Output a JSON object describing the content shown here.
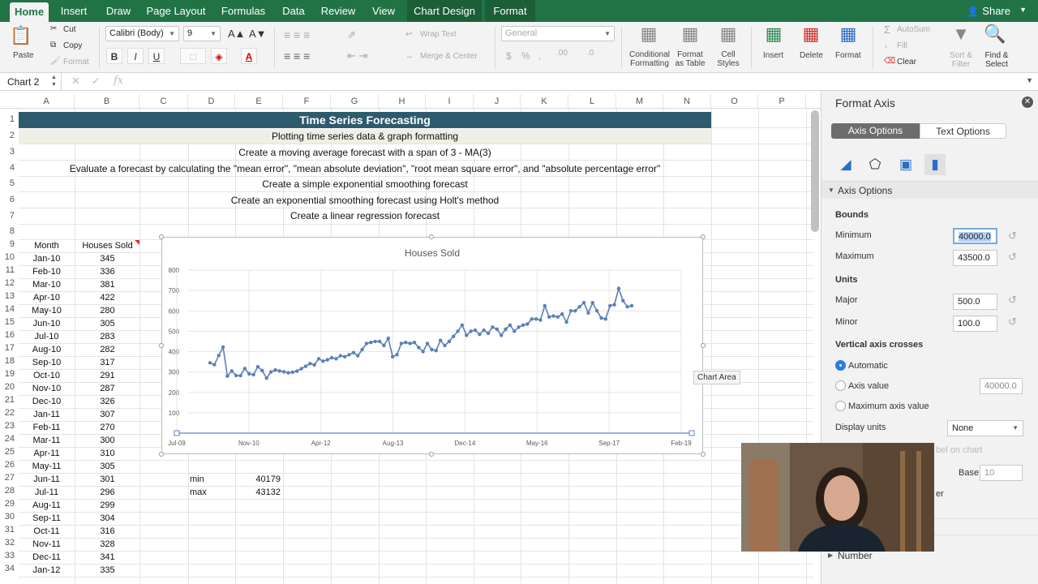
{
  "tabs": [
    "Home",
    "Insert",
    "Draw",
    "Page Layout",
    "Formulas",
    "Data",
    "Review",
    "View",
    "Chart Design",
    "Format"
  ],
  "share": "Share",
  "ribbon": {
    "paste": "Paste",
    "cut": "Cut",
    "copy": "Copy",
    "format": "Format",
    "font": "Calibri (Body)",
    "size": "9",
    "bold": "B",
    "italic": "I",
    "underline": "U",
    "wrap": "Wrap Text",
    "merge": "Merge & Center",
    "numfmt": "General",
    "pct": "%",
    "cond": "Conditional\nFormatting",
    "fmt_table": "Format\nas Table",
    "cell_styles": "Cell\nStyles",
    "insert": "Insert",
    "delete": "Delete",
    "format_btn": "Format",
    "autosum": "AutoSum",
    "fill": "Fill",
    "clear": "Clear",
    "sort": "Sort &\nFilter",
    "find": "Find &\nSelect"
  },
  "namebox": "Chart 2",
  "fx": "fx",
  "columns": [
    "A",
    "B",
    "C",
    "D",
    "E",
    "F",
    "G",
    "H",
    "I",
    "J",
    "K",
    "L",
    "M",
    "N",
    "O",
    "P"
  ],
  "banners": [
    "Time Series Forecasting",
    "Plotting time series data & graph formatting",
    "Create a moving average forecast with a span of 3 - MA(3)",
    "Evaluate a forecast by calculating the \"mean error\", \"mean absolute deviation\", \"root mean square error\", and \"absolute percentage error\"",
    "Create a simple exponential smoothing forecast",
    "Create an exponential smoothing forecast using Holt's method",
    "Create a linear regression forecast"
  ],
  "hdr": {
    "month": "Month",
    "sold": "Houses Sold"
  },
  "rows": [
    [
      "Jan-10",
      "345"
    ],
    [
      "Feb-10",
      "336"
    ],
    [
      "Mar-10",
      "381"
    ],
    [
      "Apr-10",
      "422"
    ],
    [
      "May-10",
      "280"
    ],
    [
      "Jun-10",
      "305"
    ],
    [
      "Jul-10",
      "283"
    ],
    [
      "Aug-10",
      "282"
    ],
    [
      "Sep-10",
      "317"
    ],
    [
      "Oct-10",
      "291"
    ],
    [
      "Nov-10",
      "287"
    ],
    [
      "Dec-10",
      "326"
    ],
    [
      "Jan-11",
      "307"
    ],
    [
      "Feb-11",
      "270"
    ],
    [
      "Mar-11",
      "300"
    ],
    [
      "Apr-11",
      "310"
    ],
    [
      "May-11",
      "305"
    ],
    [
      "Jun-11",
      "301"
    ],
    [
      "Jul-11",
      "296"
    ],
    [
      "Aug-11",
      "299"
    ],
    [
      "Sep-11",
      "304"
    ],
    [
      "Oct-11",
      "316"
    ],
    [
      "Nov-11",
      "328"
    ],
    [
      "Dec-11",
      "341"
    ],
    [
      "Jan-12",
      "335"
    ]
  ],
  "minmax": {
    "min_lbl": "min",
    "min_val": "40179",
    "max_lbl": "max",
    "max_val": "43132"
  },
  "chart_tip": "Chart Area",
  "chart_data": {
    "type": "line",
    "title": "Houses Sold",
    "xlabel": "",
    "ylabel": "",
    "ylim": [
      0,
      800
    ],
    "yticks": [
      "0",
      "100",
      "200",
      "300",
      "400",
      "500",
      "600",
      "700",
      "800"
    ],
    "xtick_labels": [
      "Jul-09",
      "Nov-10",
      "Apr-12",
      "Aug-13",
      "Dec-14",
      "May-16",
      "Sep-17",
      "Feb-19"
    ],
    "series": [
      {
        "values": [
          345,
          336,
          381,
          422,
          280,
          305,
          283,
          282,
          317,
          291,
          287,
          326,
          307,
          270,
          300,
          310,
          305,
          301,
          296,
          299,
          304,
          316,
          328,
          341,
          335,
          365,
          353,
          360,
          370,
          365,
          380,
          375,
          385,
          395,
          380,
          410,
          440,
          445,
          450,
          450,
          430,
          465,
          375,
          385,
          440,
          445,
          440,
          445,
          420,
          400,
          440,
          410,
          405,
          455,
          430,
          450,
          475,
          500,
          530,
          480,
          500,
          505,
          485,
          505,
          490,
          520,
          510,
          480,
          510,
          530,
          500,
          520,
          530,
          535,
          560,
          560,
          555,
          625,
          570,
          575,
          570,
          585,
          545,
          600,
          600,
          620,
          640,
          590,
          640,
          600,
          565,
          560,
          625,
          630,
          710,
          650,
          620,
          625
        ]
      }
    ],
    "grid": true,
    "legend": "none"
  },
  "panel": {
    "title": "Format Axis",
    "axis_options": "Axis Options",
    "text_options": "Text Options",
    "section": "Axis Options",
    "bounds": "Bounds",
    "minimum": "Minimum",
    "min_val": "40000.0",
    "maximum": "Maximum",
    "max_val": "43500.0",
    "units": "Units",
    "major": "Major",
    "major_val": "500.0",
    "minor": "Minor",
    "minor_val": "100.0",
    "vcross": "Vertical axis crosses",
    "automatic": "Automatic",
    "axis_value": "Axis value",
    "axis_value_val": "40000.0",
    "max_axis": "Maximum axis value",
    "display_units": "Display units",
    "display_val": "None",
    "show_label": "bel on chart",
    "base": "Base",
    "base_val": "10",
    "number": "Number",
    "partial": "er"
  }
}
